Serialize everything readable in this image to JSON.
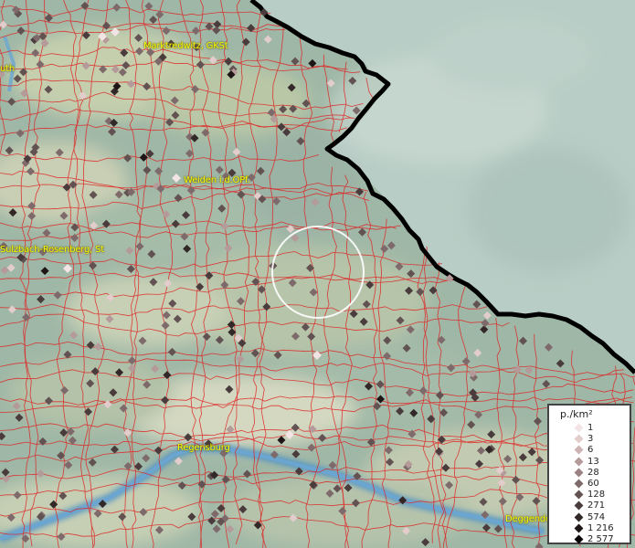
{
  "cities": [
    {
      "id": "marktredwitz",
      "label": "Marktredwitz, GKSt"
    },
    {
      "id": "weiden",
      "label": "Weiden i.d.OPf."
    },
    {
      "id": "sulzbach",
      "label": "Sulzbach-Rosenberg, St"
    },
    {
      "id": "regensburg",
      "label": "Regensburg"
    },
    {
      "id": "deggendorf",
      "label": "Deggendorf"
    },
    {
      "id": "bayreuth-partial",
      "label": "uth"
    }
  ],
  "legend": {
    "title": "p./km²",
    "entries": [
      {
        "value": "1",
        "color": "#f2e4e4"
      },
      {
        "value": "3",
        "color": "#e2cccc"
      },
      {
        "value": "6",
        "color": "#cdb3b3"
      },
      {
        "value": "13",
        "color": "#b59a9a"
      },
      {
        "value": "28",
        "color": "#9b8282"
      },
      {
        "value": "60",
        "color": "#7e6a6a"
      },
      {
        "value": "128",
        "color": "#635252"
      },
      {
        "value": "271",
        "color": "#4a3c3c"
      },
      {
        "value": "574",
        "color": "#332828"
      },
      {
        "value": "1 216",
        "color": "#1e1616"
      },
      {
        "value": "2 577",
        "color": "#0a0606"
      }
    ]
  },
  "colors": {
    "border_line": "#e02020",
    "country_border": "#000000",
    "river": "#4f93c6",
    "label": "#ffff00"
  }
}
